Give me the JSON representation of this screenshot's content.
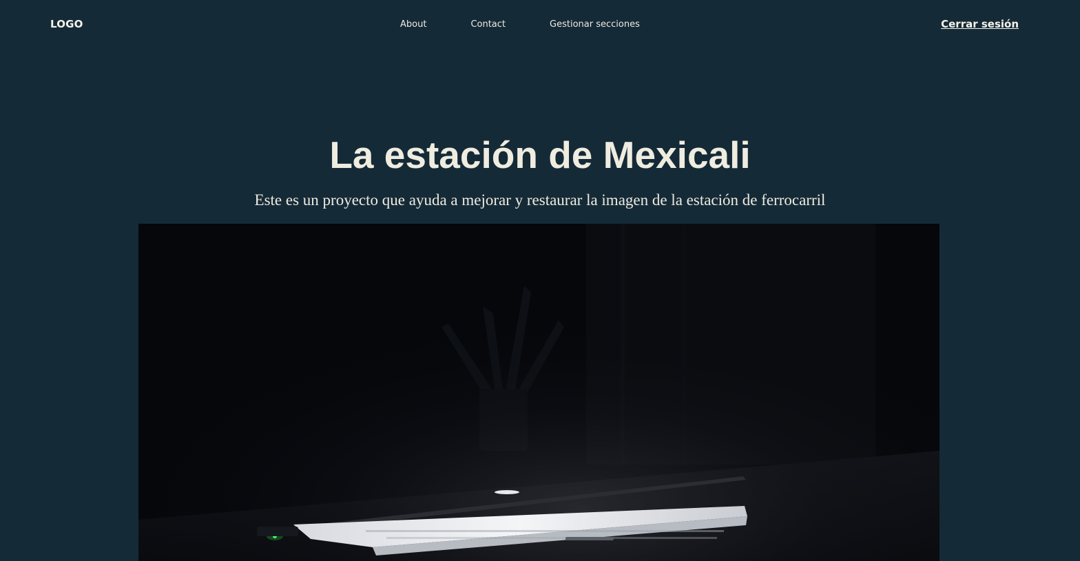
{
  "navbar": {
    "logo": "LOGO",
    "links": [
      {
        "label": "About"
      },
      {
        "label": "Contact"
      },
      {
        "label": "Gestionar secciones"
      }
    ],
    "logout_label": "Cerrar sesión"
  },
  "hero": {
    "title": "La estación de Mexicali",
    "subtitle": "Este es un proyecto que ayuda a mejorar y restaurar la imagen de la estación de ferrocarril"
  },
  "colors": {
    "background": "#152a37",
    "text": "#efece0",
    "image_background": "#06070b"
  }
}
